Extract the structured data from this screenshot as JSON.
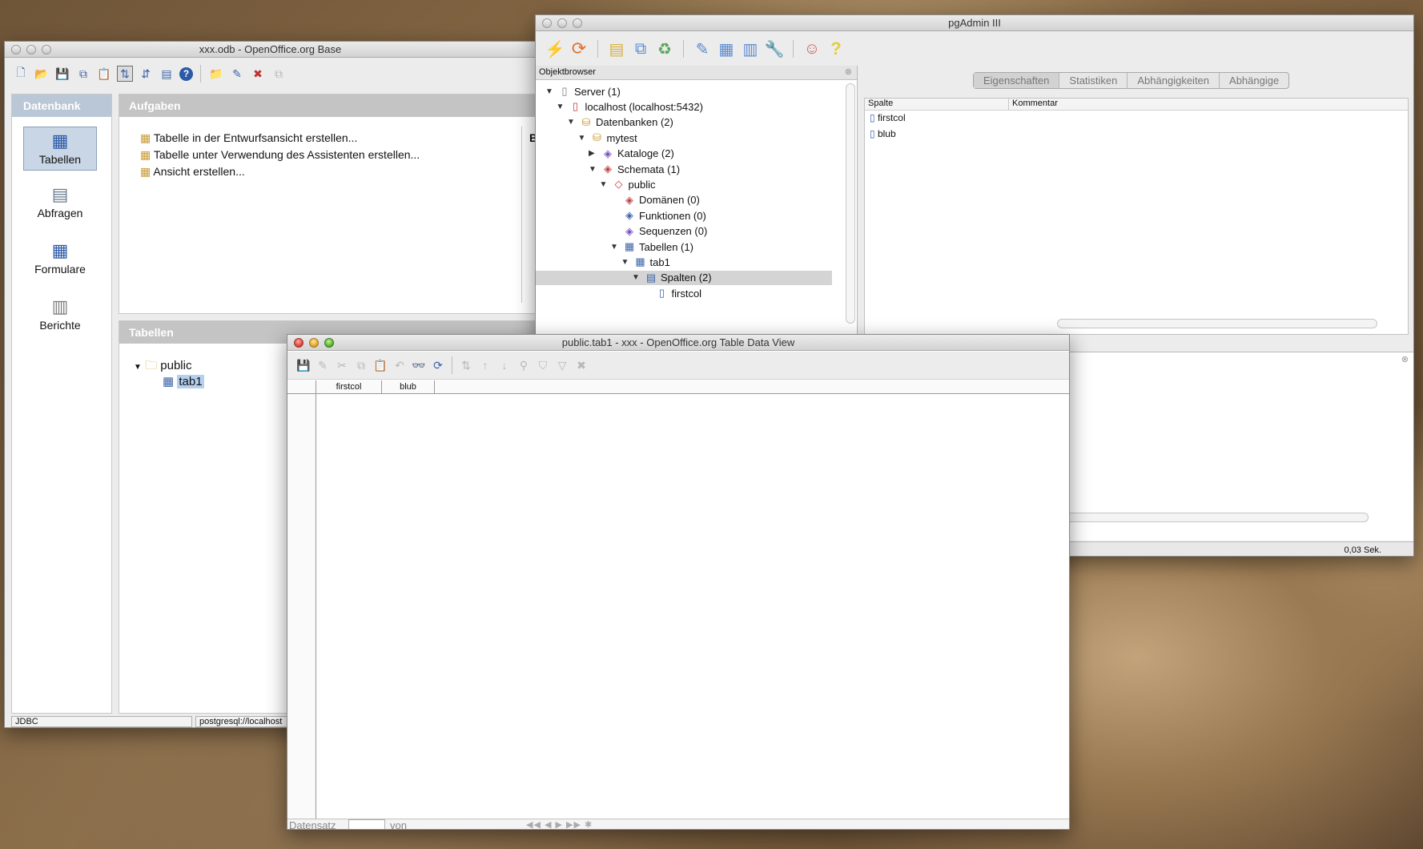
{
  "base_window": {
    "title": "xxx.odb - OpenOffice.org Base",
    "sidebar_header": "Datenbank",
    "sidebar_items": [
      {
        "label": "Tabellen",
        "icon": "tables-icon"
      },
      {
        "label": "Abfragen",
        "icon": "queries-icon"
      },
      {
        "label": "Formulare",
        "icon": "forms-icon"
      },
      {
        "label": "Berichte",
        "icon": "reports-icon"
      }
    ],
    "tasks_header": "Aufgaben",
    "tasks": [
      "Tabelle in der Entwurfsansicht erstellen...",
      "Tabelle unter Verwendung des Assistenten erstellen...",
      "Ansicht erstellen..."
    ],
    "description_header": "B",
    "tables_header": "Tabellen",
    "tree": {
      "folder": "public",
      "table": "tab1"
    },
    "status_driver": "JDBC",
    "status_url": "postgresql://localhost"
  },
  "pgadmin": {
    "title": "pgAdmin III",
    "browser_header": "Objektbrowser",
    "tree": [
      {
        "label": "Server (1)",
        "arrow": "▼",
        "level": 0,
        "icon": "server-group-icon"
      },
      {
        "label": "localhost (localhost:5432)",
        "arrow": "▼",
        "level": 1,
        "icon": "server-icon"
      },
      {
        "label": "Datenbanken (2)",
        "arrow": "▼",
        "level": 2,
        "icon": "databases-icon"
      },
      {
        "label": "mytest",
        "arrow": "▼",
        "level": 3,
        "icon": "database-icon"
      },
      {
        "label": "Kataloge (2)",
        "arrow": "▶",
        "level": 4,
        "icon": "catalogs-icon"
      },
      {
        "label": "Schemata (1)",
        "arrow": "▼",
        "level": 4,
        "icon": "schemas-icon"
      },
      {
        "label": "public",
        "arrow": "▼",
        "level": 5,
        "icon": "schema-icon"
      },
      {
        "label": "Domänen (0)",
        "arrow": "",
        "level": 6,
        "icon": "domains-icon"
      },
      {
        "label": "Funktionen (0)",
        "arrow": "",
        "level": 6,
        "icon": "functions-icon"
      },
      {
        "label": "Sequenzen (0)",
        "arrow": "",
        "level": 6,
        "icon": "sequences-icon"
      },
      {
        "label": "Tabellen (1)",
        "arrow": "▼",
        "level": 6,
        "icon": "tables-icon"
      },
      {
        "label": "tab1",
        "arrow": "▼",
        "level": 7,
        "icon": "table-icon"
      },
      {
        "label": "Spalten (2)",
        "arrow": "▼",
        "level": 8,
        "icon": "columns-icon"
      },
      {
        "label": "firstcol",
        "arrow": "",
        "level": 9,
        "icon": "column-icon"
      }
    ],
    "tabs": [
      "Eigenschaften",
      "Statistiken",
      "Abhängigkeiten",
      "Abhängige"
    ],
    "list_headers": [
      "Spalte",
      "Kommentar"
    ],
    "list_rows": [
      "firstcol",
      "blub"
    ],
    "status_time": "0,03 Sek."
  },
  "dataview": {
    "title": "public.tab1 - xxx - OpenOffice.org Table Data View",
    "columns": [
      "firstcol",
      "blub"
    ],
    "nav_label": "Datensatz",
    "nav_of": "von"
  }
}
